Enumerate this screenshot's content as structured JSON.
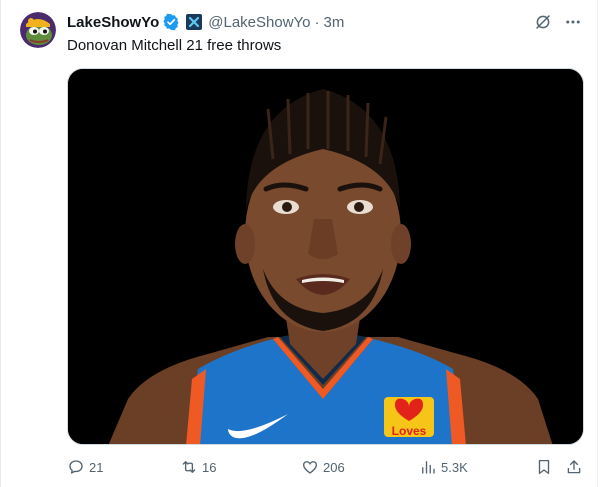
{
  "author": {
    "display_name": "LakeShowYo",
    "handle": "@LakeShowYo",
    "time": "3m",
    "separator": "·",
    "verified": true,
    "accent_color": "#1d9bf0"
  },
  "tweet": {
    "text": "Donovan Mitchell 21 free throws"
  },
  "media": {
    "jersey_sponsor": "Loves"
  },
  "actions": {
    "replies": "21",
    "reposts": "16",
    "likes": "206",
    "views": "5.3K"
  },
  "icons": {
    "verified": "verified-badge-icon",
    "affiliate": "affiliate-x-icon",
    "grok": "grok-icon",
    "more": "more-icon",
    "reply": "reply-icon",
    "repost": "repost-icon",
    "like": "heart-icon",
    "views": "views-icon",
    "bookmark": "bookmark-icon",
    "share": "share-icon"
  },
  "colors": {
    "text_primary": "#0f1419",
    "text_secondary": "#536471",
    "jersey_blue": "#1d74c9",
    "jersey_orange": "#ef5a24"
  }
}
